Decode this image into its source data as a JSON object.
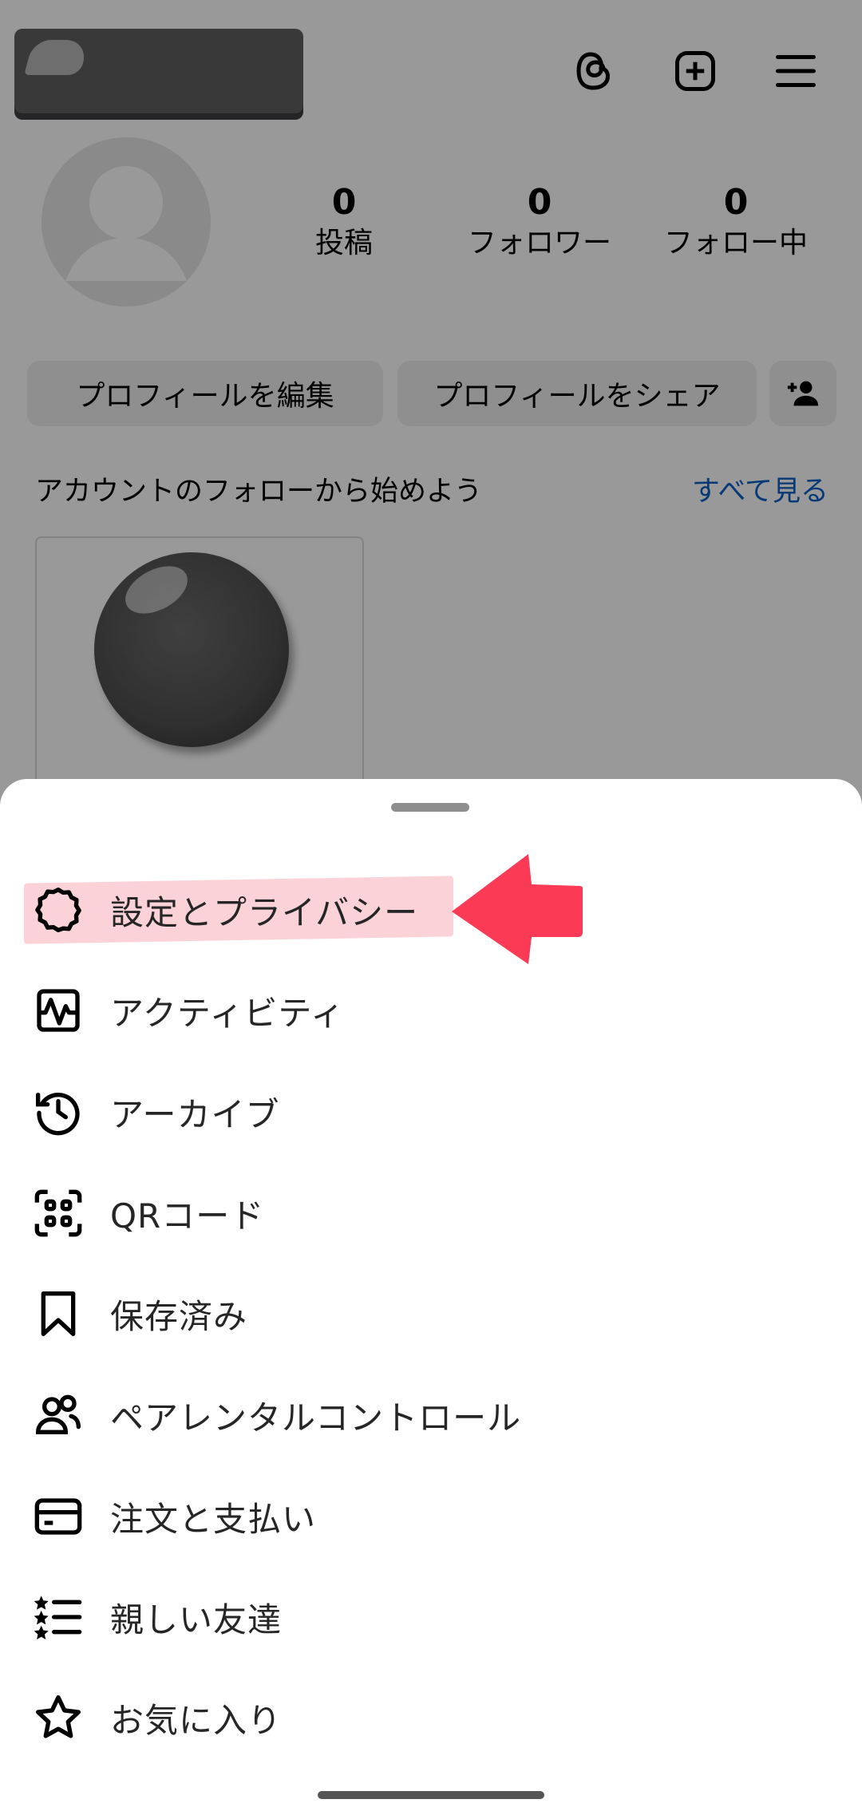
{
  "profile": {
    "stats": [
      {
        "value": "0",
        "label": "投稿"
      },
      {
        "value": "0",
        "label": "フォロワー"
      },
      {
        "value": "0",
        "label": "フォロー中"
      }
    ],
    "edit_profile_label": "プロフィールを編集",
    "share_profile_label": "プロフィールをシェア",
    "suggest_title": "アカウントのフォローから始めよう",
    "see_all_label": "すべて見る"
  },
  "header_icons": [
    "threads-icon",
    "create-plus-icon",
    "hamburger-menu-icon"
  ],
  "menu": {
    "items": [
      {
        "label": "設定とプライバシー",
        "icon": "gear-icon"
      },
      {
        "label": "アクティビティ",
        "icon": "activity-icon"
      },
      {
        "label": "アーカイブ",
        "icon": "archive-history-icon"
      },
      {
        "label": "QRコード",
        "icon": "qr-code-icon"
      },
      {
        "label": "保存済み",
        "icon": "bookmark-icon"
      },
      {
        "label": "ペアレンタルコントロール",
        "icon": "family-icon"
      },
      {
        "label": "注文と支払い",
        "icon": "card-icon"
      },
      {
        "label": "親しい友達",
        "icon": "star-list-icon"
      },
      {
        "label": "お気に入り",
        "icon": "star-icon"
      }
    ]
  },
  "colors": {
    "highlight": "#fbd2d8",
    "arrow": "#fb3a55",
    "link": "#0a5fc4"
  }
}
